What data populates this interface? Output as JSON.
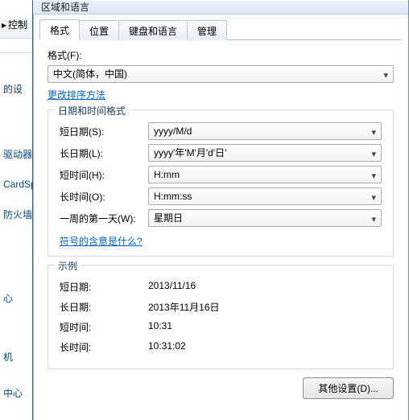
{
  "window": {
    "title": "区域和语言"
  },
  "breadcrumb": {
    "label": "控制"
  },
  "sidebar": {
    "heading": "的设",
    "items": [
      "驱动器",
      "CardSp",
      "防火墙"
    ],
    "links": [
      "心",
      "",
      "机",
      "中心"
    ]
  },
  "tabs": {
    "format": "格式",
    "location": "位置",
    "keyboards": "键盘和语言",
    "admin": "管理"
  },
  "format": {
    "label": "格式(F):",
    "value": "中文(简体，中国)",
    "change_sort": "更改排序方法"
  },
  "dtgroup": {
    "legend": "日期和时间格式",
    "short_date_label": "短日期(S):",
    "short_date_value": "yyyy/M/d",
    "long_date_label": "长日期(L):",
    "long_date_value": "yyyy'年'M'月'd'日'",
    "short_time_label": "短时间(H):",
    "short_time_value": "H:mm",
    "long_time_label": "长时间(O):",
    "long_time_value": "H:mm:ss",
    "first_day_label": "一周的第一天(W):",
    "first_day_value": "星期日",
    "notation_link": "符号的含意是什么?"
  },
  "example": {
    "legend": "示例",
    "short_date_label": "短日期:",
    "short_date_value": "2013/11/16",
    "long_date_label": "长日期:",
    "long_date_value": "2013年11月16日",
    "short_time_label": "短时间:",
    "short_time_value": "10:31",
    "long_time_label": "长时间:",
    "long_time_value": "10:31:02"
  },
  "buttons": {
    "additional": "其他设置(D)..."
  }
}
